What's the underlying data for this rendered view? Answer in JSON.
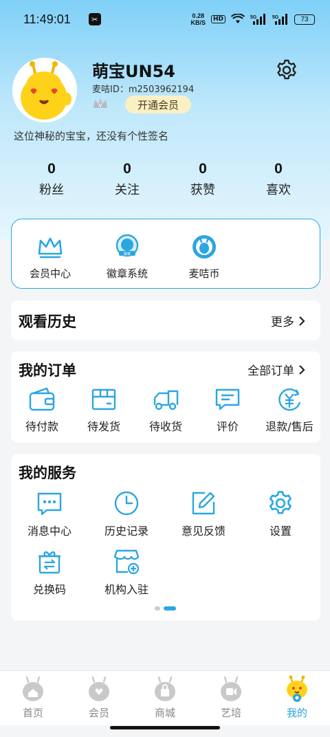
{
  "status_bar": {
    "time": "11:49:01",
    "net_speed_value": "0.28",
    "net_speed_unit": "KB/S",
    "hd": "HD",
    "battery": "73"
  },
  "profile": {
    "nickname": "萌宝UN54",
    "user_id": "麦咭ID：m2503962194",
    "vip_button": "开通会员",
    "bio": "这位神秘的宝宝，还没有个性签名"
  },
  "stats": [
    {
      "num": "0",
      "label": "粉丝"
    },
    {
      "num": "0",
      "label": "关注"
    },
    {
      "num": "0",
      "label": "获赞"
    },
    {
      "num": "0",
      "label": "喜欢"
    }
  ],
  "features": [
    {
      "label": "会员中心",
      "icon": "crown-icon"
    },
    {
      "label": "徽章系统",
      "icon": "badge-icon"
    },
    {
      "label": "麦咭币",
      "icon": "coin-icon"
    }
  ],
  "history": {
    "title": "观看历史",
    "more": "更多"
  },
  "orders": {
    "title": "我的订单",
    "more": "全部订单",
    "items": [
      {
        "label": "待付款",
        "icon": "wallet-icon"
      },
      {
        "label": "待发货",
        "icon": "box-icon"
      },
      {
        "label": "待收货",
        "icon": "truck-icon"
      },
      {
        "label": "评价",
        "icon": "comment-icon"
      },
      {
        "label": "退款/售后",
        "icon": "refund-icon"
      }
    ]
  },
  "services": {
    "title": "我的服务",
    "items": [
      {
        "label": "消息中心",
        "icon": "message-icon"
      },
      {
        "label": "历史记录",
        "icon": "clock-icon"
      },
      {
        "label": "意见反馈",
        "icon": "edit-icon"
      },
      {
        "label": "设置",
        "icon": "gear-icon"
      },
      {
        "label": "兑换码",
        "icon": "gift-exchange-icon"
      },
      {
        "label": "机构入驻",
        "icon": "store-add-icon"
      }
    ]
  },
  "bottom_nav": [
    {
      "label": "首页",
      "active": false
    },
    {
      "label": "会员",
      "active": false
    },
    {
      "label": "商城",
      "active": false
    },
    {
      "label": "艺培",
      "active": false
    },
    {
      "label": "我的",
      "active": true
    }
  ],
  "colors": {
    "accent": "#2aa6e0",
    "vip_bg": "#fbf0c4"
  }
}
